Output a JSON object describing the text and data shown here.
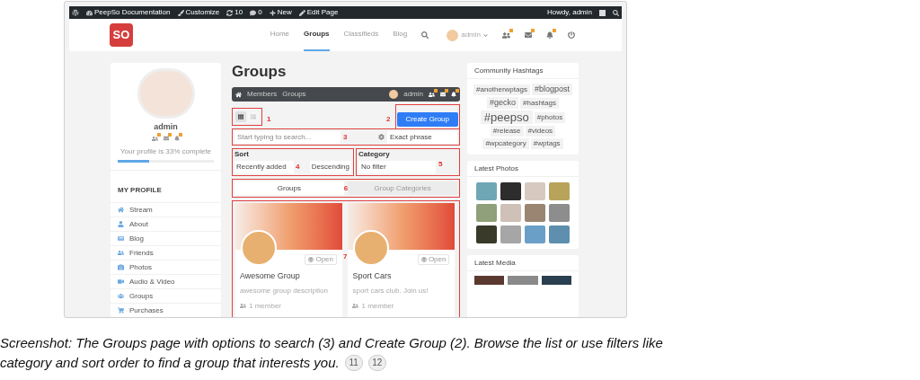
{
  "admin_bar": {
    "items": [
      {
        "kind": "site",
        "label": "PeepSo Documentation"
      },
      {
        "kind": "customize",
        "label": "Customize"
      },
      {
        "kind": "updates",
        "label": "10"
      },
      {
        "kind": "comments",
        "label": "0"
      },
      {
        "kind": "new",
        "label": "New"
      },
      {
        "kind": "edit",
        "label": "Edit Page"
      }
    ],
    "greeting": "Howdy, admin"
  },
  "header": {
    "logo": "SO",
    "nav": [
      {
        "label": "Home",
        "selected": false
      },
      {
        "label": "Groups",
        "selected": true
      },
      {
        "label": "Classifieds",
        "selected": false
      },
      {
        "label": "Blog",
        "selected": false
      }
    ],
    "user": "admin"
  },
  "profile": {
    "name": "admin",
    "progress_text": "Your profile is 33% complete",
    "level": 0.33,
    "section_title": "MY PROFILE",
    "menu": [
      {
        "kind": "home",
        "label": "Stream"
      },
      {
        "kind": "user",
        "label": "About"
      },
      {
        "kind": "blog",
        "label": "Blog"
      },
      {
        "kind": "friends",
        "label": "Friends"
      },
      {
        "kind": "photos",
        "label": "Photos"
      },
      {
        "kind": "video",
        "label": "Audio & Video"
      },
      {
        "kind": "groups",
        "label": "Groups"
      },
      {
        "kind": "cart",
        "label": "Purchases"
      }
    ]
  },
  "main": {
    "title": "Groups",
    "subnav": [
      "Members",
      "Groups"
    ],
    "user": "admin",
    "view_modes": [
      {
        "kind": "grid",
        "selected": true
      },
      {
        "kind": "list",
        "selected": false
      }
    ],
    "view_callout": "1",
    "create_button": "Create Group",
    "create_callout": "2",
    "search": {
      "placeholder": "Start typing to search...",
      "mode": "Exact phrase",
      "callout": "3"
    },
    "sort": {
      "label": "Sort",
      "order_by": "Recently added",
      "direction": "Descending",
      "callout": "4"
    },
    "category": {
      "label": "Category",
      "value": "No filter",
      "callout": "5"
    },
    "tabs": [
      {
        "label": "Groups",
        "selected": true
      },
      {
        "label": "Group Categories",
        "selected": false
      }
    ],
    "tabs_callout": "6",
    "groups_callout": "7",
    "groups": [
      {
        "name": "Awesome Group",
        "description": "awesome group description",
        "privacy": "Open",
        "members": "1 member"
      },
      {
        "name": "Sport Cars",
        "description": "sport cars club. Join us!",
        "privacy": "Open",
        "members": "1 member"
      }
    ]
  },
  "sidebar": {
    "hashtags_title": "Community Hashtags",
    "hashtags": [
      {
        "kind": "small",
        "label": "#anotherwptags"
      },
      {
        "kind": "medium",
        "label": "#blogpost"
      },
      {
        "kind": "medium",
        "label": "#gecko"
      },
      {
        "kind": "small",
        "label": "#hashtags"
      },
      {
        "kind": "large",
        "label": "#peepso"
      },
      {
        "kind": "small",
        "label": "#photos"
      },
      {
        "kind": "small",
        "label": "#release"
      },
      {
        "kind": "small",
        "label": "#videos"
      },
      {
        "kind": "small",
        "label": "#wpcategory"
      },
      {
        "kind": "small",
        "label": "#wptags"
      }
    ],
    "photos_title": "Latest Photos",
    "media_title": "Latest Media"
  },
  "caption": {
    "lines": [
      "Screenshot: The Groups page with options to search (3) and Create Group (2). Browse the list or use filters like",
      "category and sort order to find a group that interests you."
    ],
    "refs": [
      "11",
      "12"
    ]
  }
}
